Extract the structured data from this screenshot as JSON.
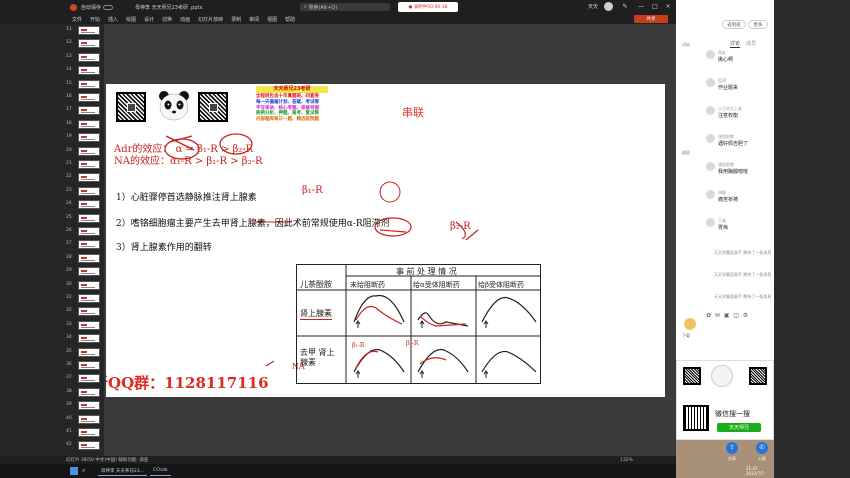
{
  "window": {
    "autosave_label": "自动保存",
    "doc_title": "母神李 天天师兄23考研 .pptx",
    "search_placeholder": "搜索(Alt+Q)",
    "recording_label": "录制中00:06:38",
    "user_name": "天天",
    "present_button": "共享"
  },
  "menu": [
    "文件",
    "开始",
    "插入",
    "绘图",
    "设计",
    "切换",
    "动画",
    "幻灯片放映",
    "录制",
    "审阅",
    "视图",
    "帮助"
  ],
  "thumbnails": [
    "11",
    "12",
    "13",
    "14",
    "15",
    "16",
    "17",
    "18",
    "19",
    "20",
    "21",
    "22",
    "23",
    "24",
    "25",
    "26",
    "27",
    "28",
    "29",
    "30",
    "31",
    "32",
    "33",
    "34",
    "35",
    "36",
    "37",
    "38",
    "39",
    "40",
    "41",
    "42"
  ],
  "slide": {
    "banner_title": "天天师兄23考研",
    "banner_lines": [
      {
        "text": "全程班包含十年真题班、四套卷",
        "color": "#e1141b"
      },
      {
        "text": "每一天循循计划、答疑、考试等",
        "color": "#1d3fd1"
      },
      {
        "text": "手写串讲、核心考题、思维导图",
        "color": "#d41cd1"
      },
      {
        "text": "病例分析、押题、报考、复试等",
        "color": "#17a11e"
      },
      {
        "text": "内部题库每日一题、精选医院题",
        "color": "#e66a12"
      }
    ],
    "heading": "串联",
    "adr_line": "Adr的效应：  α = β₁-R > β₂-R",
    "na_line": "NA的效应：α₁-R > β₁-R > β₂-R",
    "items": [
      "1）心脏骤停首选静脉推注肾上腺素",
      "2）嗜铬细胞瘤主要产生去甲肾上腺素，因此术前常规使用α-R阻滞剂",
      "3）肾上腺素作用的翻转"
    ],
    "handwriting": [
      "β₁-R",
      "β₁-R",
      "β₁-R",
      "β₂-R",
      "NA"
    ],
    "table": {
      "corner": "儿茶酚胺",
      "group_header": "事 前 处 理 情 况",
      "columns": [
        "未给阻断药",
        "给α受体阻断药",
        "给β受体阻断药"
      ],
      "rows": [
        "肾上腺素",
        "去甲 肾上腺素"
      ]
    },
    "footer_text": "后续更新QQ群：1128117116"
  },
  "statusbar": {
    "left": "幻灯片 38/50  中文(中国)  辅助功能: 调查",
    "zoom": "132%"
  },
  "taskbar": {
    "items": [
      "母神李 天天师兄23...",
      "CCtalk"
    ]
  },
  "live_panel": {
    "top_buttons": [
      "返利班",
      "更多"
    ],
    "tabs": [
      "讨论",
      "成员"
    ],
    "side_icons": [
      "讨论",
      "成员"
    ],
    "chats": [
      {
        "name": "网友",
        "text": "揪心啊"
      },
      {
        "name": "莹玥",
        "text": "作业题来"
      },
      {
        "name": "小王的无上老",
        "text": "注意权衡"
      },
      {
        "name": "课程助教",
        "text": "遇好佩吉胆了"
      },
      {
        "name": "课程助教",
        "text": "我用胸腺嘧啶"
      },
      {
        "name": "海豚",
        "text": "痛苦祈祷"
      },
      {
        "name": "王者",
        "text": "胃疡"
      }
    ],
    "system_msgs": [
      "天天学霸君高手 期待了一条消息",
      "天天学霸君高手 期待了一条消息",
      "天天学霸君高手 期待了一条消息"
    ],
    "handup_label": "下载",
    "wechat_search": "微信搜一搜",
    "wechat_button": "天天师兄",
    "cam_labels": [
      "分享",
      "入群"
    ],
    "clock": [
      "21:47",
      "2022/7/7"
    ]
  }
}
